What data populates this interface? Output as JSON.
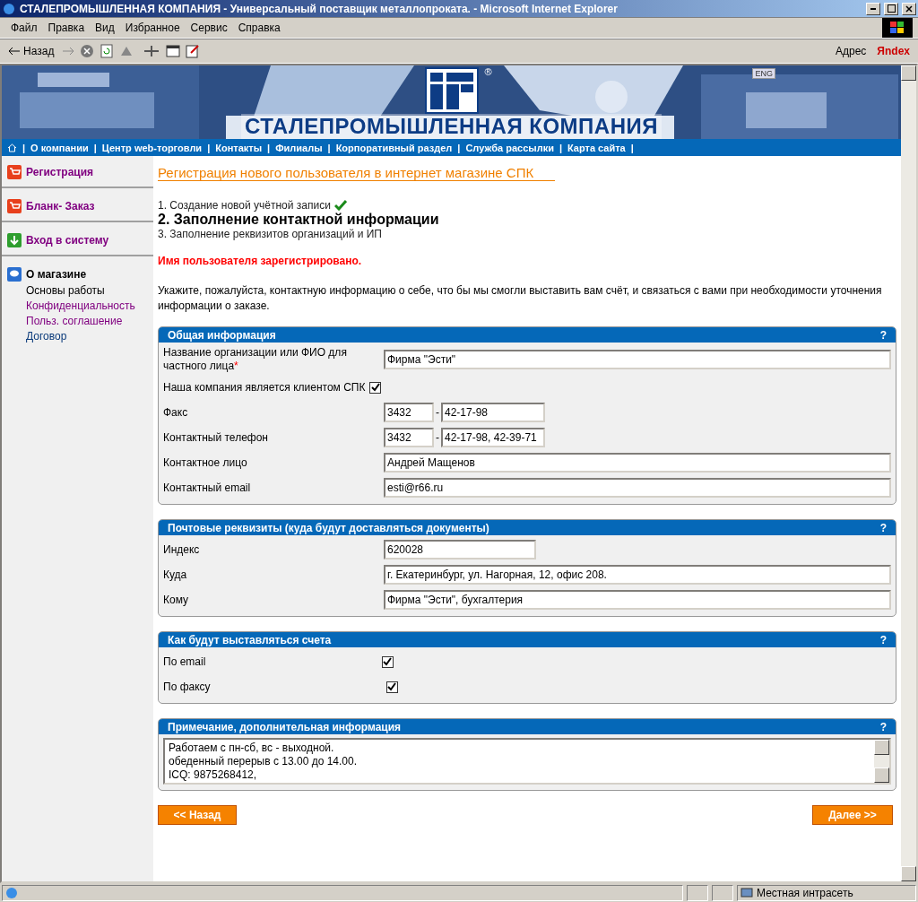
{
  "window": {
    "title": "СТАЛЕПРОМЫШЛЕННАЯ КОМПАНИЯ - Универсальный поставщик металлопроката. - Microsoft Internet Explorer"
  },
  "menu": [
    "Файл",
    "Правка",
    "Вид",
    "Избранное",
    "Сервис",
    "Справка"
  ],
  "toolbar": {
    "back": "Назад",
    "address": "Адрес",
    "search_brand": "Яndex"
  },
  "banner": {
    "logo_text": "СТАЛЕПРОМЫШЛЕННАЯ КОМПАНИЯ",
    "registered": "®",
    "language": "ENG"
  },
  "nav": {
    "home_separator": "|",
    "items": [
      {
        "label": "О компании",
        "separator": "|"
      },
      {
        "label": "Центр web-торговли",
        "separator": "|"
      },
      {
        "label": "Контакты",
        "separator": "|"
      },
      {
        "label": "Филиалы",
        "separator": "|"
      },
      {
        "label": "Корпоративный раздел",
        "separator": "|"
      },
      {
        "label": "Служба рассылки",
        "separator": "|"
      },
      {
        "label": "Карта сайта",
        "separator": "|"
      }
    ]
  },
  "sidebar": [
    {
      "label": "Регистрация",
      "kind": "cart",
      "selected": false
    },
    {
      "label": "Бланк- Заказ",
      "kind": "cart",
      "selected": false
    },
    {
      "label": "Вход в систему",
      "kind": "login",
      "selected": false
    },
    {
      "label": "О магазине",
      "kind": "chat",
      "selected": true,
      "children": [
        {
          "label": "Основы работы",
          "visited": false,
          "selected": true
        },
        {
          "label": "Конфиденциальность",
          "visited": true,
          "selected": false
        },
        {
          "label": "Польз. соглашение",
          "visited": true,
          "selected": false
        },
        {
          "label": "Договор",
          "visited": false,
          "selected": false
        }
      ]
    }
  ],
  "heading": "Регистрация нового пользователя в интернет магазине СПК",
  "steps": [
    {
      "text": "1. Создание новой учётной записи",
      "done": true,
      "current": false
    },
    {
      "text": "2. Заполнение контактной информации",
      "done": false,
      "current": true
    },
    {
      "text": "3. Заполнение реквизитов организаций и ИП",
      "done": false,
      "current": false
    }
  ],
  "message": "Имя пользователя зарегистрировано.",
  "intro": "Укажите, пожалуйста, контактную информацию о себе, что бы мы смогли выставить вам счёт, и связаться с вами при необходимости уточнения информации о заказе.",
  "panels": [
    {
      "title": "Общая информация",
      "help": "?",
      "fields": [
        {
          "kind": "text",
          "label": "Название организации или ФИО для частного лица",
          "required_mark": "*",
          "value": "Фирма \"Эсти\""
        },
        {
          "kind": "checkbox",
          "label": "Наша компания является клиентом СПК",
          "checked": true
        },
        {
          "kind": "phone",
          "label": "Факс",
          "code": "3432",
          "separator": "-",
          "value": "42-17-98"
        },
        {
          "kind": "phone",
          "label": "Контактный телефон",
          "code": "3432",
          "separator": "-",
          "value": "42-17-98, 42-39-71"
        },
        {
          "kind": "text",
          "label": "Контактное лицо",
          "value": "Андрей Мащенов"
        },
        {
          "kind": "text",
          "label": "Контактный email",
          "value": "esti@r66.ru"
        }
      ]
    },
    {
      "title": "Почтовые реквизиты (куда будут доставляться документы)",
      "help": "?",
      "fields": [
        {
          "kind": "short",
          "label": "Индекс",
          "value": "620028"
        },
        {
          "kind": "text",
          "label": "Куда",
          "value": "г. Екатеринбург, ул. Нагорная, 12, офис 208."
        },
        {
          "kind": "text",
          "label": "Кому",
          "value": "Фирма \"Эсти\", бухгалтерия"
        }
      ]
    },
    {
      "title": "Как будут выставляться счета",
      "help": "?",
      "fields": [
        {
          "kind": "checkbox",
          "label": "По email",
          "checked": true
        },
        {
          "kind": "checkbox",
          "label": "По факсу",
          "checked": true
        }
      ]
    },
    {
      "title": "Примечание, дополнительная информация",
      "help": "?",
      "fields": [
        {
          "kind": "textarea",
          "lines": [
            "Работаем с пн-сб, вс - выходной.",
            "обеденный перерыв с 13.00 до 14.00.",
            "ICQ: 9875268412,"
          ]
        }
      ]
    }
  ],
  "buttons": {
    "back": "<< Назад",
    "next": "Далее >>"
  },
  "status_bar": {
    "zone": "Местная интрасеть"
  }
}
